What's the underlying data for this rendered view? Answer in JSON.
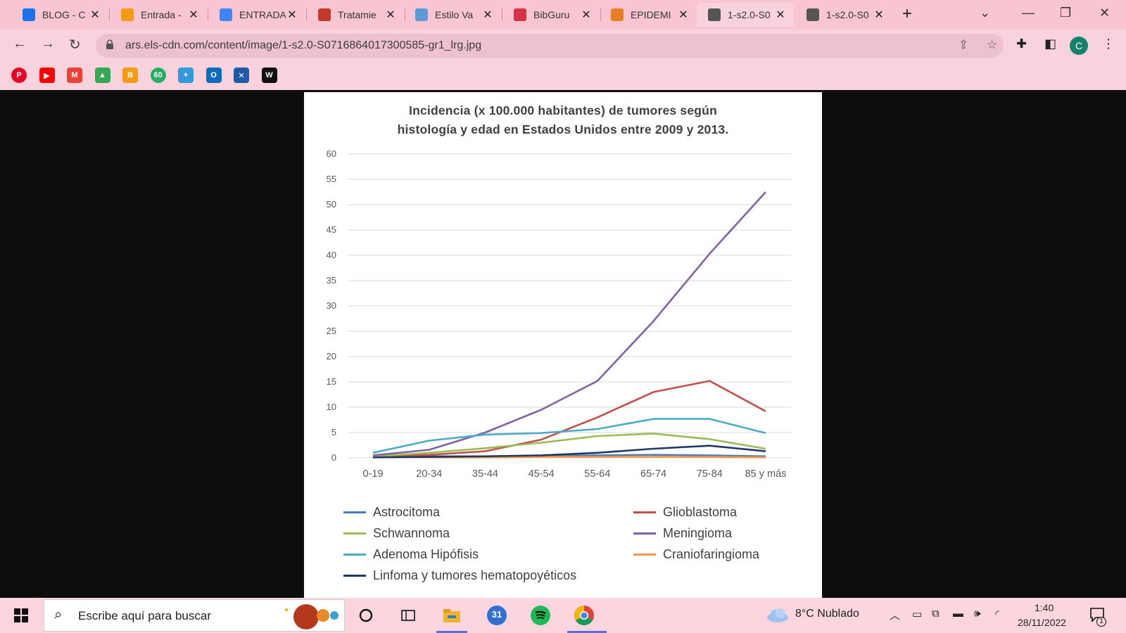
{
  "browser": {
    "tabs": [
      {
        "title": "BLOG - C",
        "icon": "google-drive-icon",
        "color": "#1a73e8"
      },
      {
        "title": "Entrada -",
        "icon": "blogger-icon",
        "color": "#f39c12"
      },
      {
        "title": "ENTRADA",
        "icon": "google-docs-icon",
        "color": "#4285f4"
      },
      {
        "title": "Tratamie",
        "icon": "ppt-icon",
        "color": "#c0392b"
      },
      {
        "title": "Estilo Va",
        "icon": "cloud-icon",
        "color": "#5b9bd5"
      },
      {
        "title": "BibGuru",
        "icon": "book-icon",
        "color": "#d63344"
      },
      {
        "title": "EPIDEMI",
        "icon": "e-icon",
        "color": "#e67e22"
      },
      {
        "title": "1-s2.0-S0",
        "icon": "globe-icon",
        "color": "#555555"
      },
      {
        "title": "1-s2.0-S0",
        "icon": "globe-icon",
        "color": "#555555"
      }
    ],
    "active_tab": 7,
    "url": "ars.els-cdn.com/content/image/1-s2.0-S0716864017300585-gr1_lrg.jpg",
    "profile_initial": "C"
  },
  "bookmarks": [
    {
      "name": "pinterest",
      "label": "P",
      "color": "#e60023"
    },
    {
      "name": "youtube",
      "label": "▶",
      "color": "#ff0000"
    },
    {
      "name": "gmail",
      "label": "M",
      "color": "#ea4335"
    },
    {
      "name": "drive",
      "label": "▲",
      "color": "#34a853"
    },
    {
      "name": "blogger",
      "label": "B",
      "color": "#f39c12"
    },
    {
      "name": "sixty",
      "label": "60",
      "color": "#27ae60"
    },
    {
      "name": "plus",
      "label": "+",
      "color": "#3498db"
    },
    {
      "name": "outlook",
      "label": "O",
      "color": "#0f6cbd"
    },
    {
      "name": "bookmark-8",
      "label": "✕",
      "color": "#1e5aa8"
    },
    {
      "name": "wattpad",
      "label": "W",
      "color": "#111111"
    }
  ],
  "chart_data": {
    "type": "line",
    "title_lines": [
      "Incidencia  (x 100.000 habitantes)  de tumores  según",
      "histología  y edad en Estados Unidos  entre 2009 y 2013."
    ],
    "categories": [
      "0-19",
      "20-34",
      "35-44",
      "45-54",
      "55-64",
      "65-74",
      "75-84",
      "85 y más"
    ],
    "ylim": [
      0,
      60
    ],
    "yticks": [
      "0",
      "5",
      "10",
      "15",
      "20",
      "25",
      "30",
      "35",
      "40",
      "45",
      "50",
      "55",
      "60"
    ],
    "grid": true,
    "legend_position": "bottom",
    "series": [
      {
        "name": "Astrocitoma",
        "color": "#4a7ebb",
        "values": [
          0.4,
          0.3,
          0.3,
          0.4,
          0.5,
          0.6,
          0.5,
          0.3
        ]
      },
      {
        "name": "Glioblastoma",
        "color": "#c0504d",
        "values": [
          0.3,
          0.6,
          1.3,
          3.6,
          8.0,
          13.0,
          15.2,
          9.2
        ]
      },
      {
        "name": "Schwannoma",
        "color": "#9bbb59",
        "values": [
          0.3,
          1.0,
          1.9,
          3.0,
          4.3,
          4.8,
          3.7,
          1.8
        ]
      },
      {
        "name": "Meningioma",
        "color": "#8064a2",
        "values": [
          0.5,
          1.6,
          5.0,
          9.5,
          15.2,
          27.0,
          40.3,
          52.5
        ]
      },
      {
        "name": "Adenoma Hipófisis",
        "color": "#4bacc6",
        "values": [
          1.0,
          3.4,
          4.6,
          4.9,
          5.7,
          7.7,
          7.7,
          4.9
        ]
      },
      {
        "name": "Craniofaringioma",
        "color": "#f79646",
        "values": [
          0.2,
          0.1,
          0.1,
          0.2,
          0.2,
          0.2,
          0.2,
          0.1
        ]
      },
      {
        "name": "Linfoma y tumores hematopoyéticos",
        "color": "#1f3864",
        "values": [
          0.1,
          0.2,
          0.3,
          0.5,
          1.0,
          1.8,
          2.4,
          1.3
        ]
      }
    ]
  },
  "taskbar": {
    "search_placeholder": "Escribe aquí para buscar",
    "calendar_day": "31",
    "weather": "8°C  Nublado",
    "time": "1:40",
    "date": "28/11/2022",
    "notification_count": "1"
  }
}
